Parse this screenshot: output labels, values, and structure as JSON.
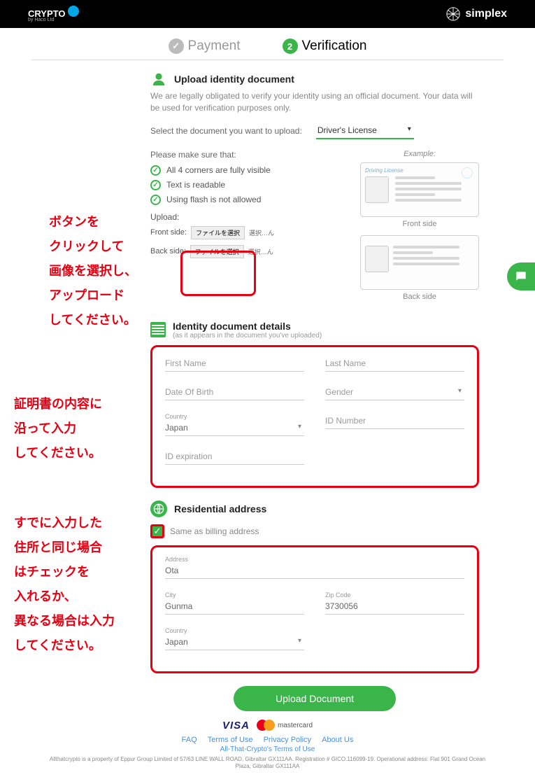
{
  "header": {
    "brand_left": "CRYPTO",
    "brand_left_sub": "by Haco Ltd",
    "brand_right": "simplex"
  },
  "steps": {
    "payment": "Payment",
    "verification": "Verification",
    "verification_num": "2"
  },
  "upload_section": {
    "title": "Upload identity document",
    "desc": "We are legally obligated to verify your identity using an official document. Your data will be used for verification purposes only.",
    "select_label": "Select the document you want to upload:",
    "select_value": "Driver's License",
    "checklist_title": "Please make sure that:",
    "checks": [
      "All 4 corners are fully visible",
      "Text is readable",
      "Using flash is not allowed"
    ],
    "upload_label": "Upload:",
    "front_side": "Front side:",
    "back_side": "Back side:",
    "file_button": "ファイルを選択",
    "file_status": "選択…ん",
    "example_label": "Example:",
    "example_card_title": "Driving License",
    "front_caption": "Front side",
    "back_caption": "Back side"
  },
  "details_section": {
    "title": "Identity document details",
    "sub": "(as it appears in the document you've uploaded)",
    "first_name": "First Name",
    "last_name": "Last Name",
    "dob": "Date Of Birth",
    "gender": "Gender",
    "country_label": "Country",
    "country_value": "Japan",
    "id_number": "ID Number",
    "id_expiration": "ID expiration"
  },
  "address_section": {
    "title": "Residential address",
    "same_label": "Same as billing address",
    "address_label": "Address",
    "address_value": "Ota",
    "city_label": "City",
    "city_value": "Gunma",
    "zip_label": "Zip Code",
    "zip_value": "3730056",
    "country_label": "Country",
    "country_value": "Japan"
  },
  "submit": "Upload Document",
  "footer": {
    "visa": "VISA",
    "mastercard": "mastercard",
    "links": [
      "FAQ",
      "Terms of Use",
      "Privacy Policy",
      "About Us"
    ],
    "sublink": "All-That-Crypto's Terms of Use",
    "legal": "Allthatcrypto is a property of Eppur Group Limited of 57/63 LINE WALL ROAD, Gibraltar GX111AA. Registration # GICO.116099-19. Operational address: Flat 901 Grand Ocean Plaza, Gibraltar GX111AA"
  },
  "annotations": {
    "a1": "ボタンを\nクリックして\n画像を選択し、\nアップロード\nしてください。",
    "a2": "証明書の内容に\n沿って入力\nしてください。",
    "a3": "すでに入力した\n住所と同じ場合\nはチェックを\n入れるか、\n異なる場合は入力\nしてください。"
  }
}
